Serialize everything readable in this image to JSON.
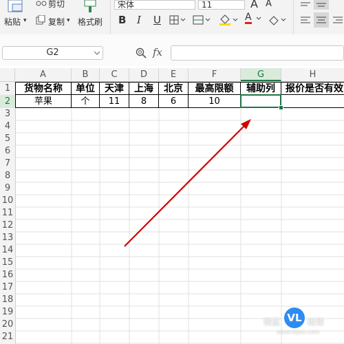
{
  "ribbon": {
    "cut_label": "剪切",
    "paste_label": "粘贴",
    "paste_arrow": "▾",
    "copy_label": "复制",
    "copy_arrow": "▾",
    "format_painter_label": "格式刷",
    "font_name": "宋体",
    "font_size": "11",
    "increase_font": "A",
    "decrease_font": "A",
    "bold": "B",
    "italic": "I",
    "underline": "U",
    "font_color_letter": "A"
  },
  "formula_bar": {
    "name_box": "G2",
    "zoom_icon": "⌕",
    "fx_label": "fx",
    "formula_value": ""
  },
  "columns": [
    {
      "letter": "A"
    },
    {
      "letter": "B"
    },
    {
      "letter": "C"
    },
    {
      "letter": "D"
    },
    {
      "letter": "E"
    },
    {
      "letter": "F"
    },
    {
      "letter": "G"
    },
    {
      "letter": "H"
    }
  ],
  "rows": [
    "1",
    "2",
    "3",
    "4",
    "5",
    "6",
    "7",
    "8",
    "9",
    "10",
    "11",
    "12",
    "13",
    "14",
    "15",
    "16",
    "17",
    "18",
    "19",
    "20",
    "21"
  ],
  "sheet": {
    "header_row": [
      "货物名称",
      "单位",
      "天津",
      "上海",
      "北京",
      "最高限额",
      "辅助列",
      "报价是否有效"
    ],
    "data_row": [
      "苹果",
      "个",
      "11",
      "8",
      "6",
      "10",
      "",
      ""
    ]
  },
  "selection": {
    "active_cell": "G2"
  },
  "colors": {
    "accent": "#217346",
    "arrow": "#d00000"
  },
  "watermark": {
    "left_text": "微蓝",
    "badge": "VL",
    "right_text": "经验",
    "url": "www.vlpos.com"
  }
}
